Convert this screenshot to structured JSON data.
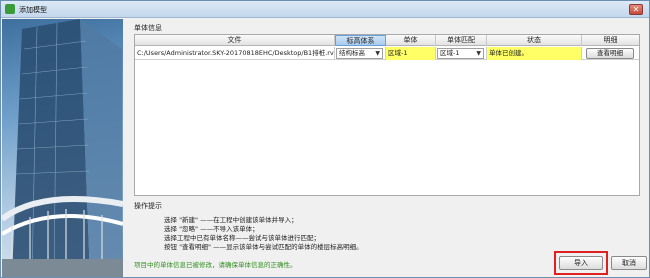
{
  "window": {
    "title": "添加模型",
    "close_symbol": "✕"
  },
  "sections": {
    "monomer_info": "单体信息",
    "hints": "操作提示"
  },
  "table": {
    "headers": [
      "文件",
      "标高体系",
      "单体",
      "单体匹配",
      "状态",
      "明细"
    ],
    "rows": [
      {
        "file": "C:/Users/Administrator.SKY-20170818EHC/Desktop/B1排桩.rvt.E5D",
        "elevation_system": "结构标高",
        "monomer": "区域-1",
        "monomer_match": "区域-1",
        "status": "单体已创建。",
        "detail_button": "查看明细"
      }
    ]
  },
  "hints": [
    "选择 \"新建\" ——在工程中创建该单体并导入；",
    "选择 \"忽略\" ——不导入该单体；",
    "选择工程中已有单体名称——尝试与该单体进行匹配；",
    "按钮 \"查看明细\" ——显示该单体与尝试匹配的单体的楼层标高明细。"
  ],
  "status_message": "项目中的单体信息已被修改，请确保单体信息的正确性。",
  "buttons": {
    "import": "导入",
    "cancel": "取消"
  },
  "colors": {
    "highlight": "#ffff66",
    "status_green": "#2f8f1f",
    "annotation_red": "#e02020"
  }
}
